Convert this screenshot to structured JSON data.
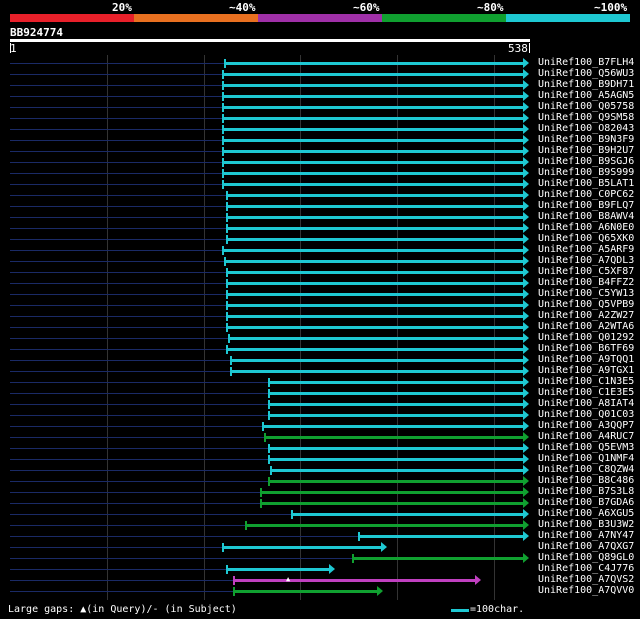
{
  "scale": {
    "labels": [
      "20%",
      "~40%",
      "~60%",
      "~80%",
      "~100%"
    ],
    "colors": [
      "#e8202a",
      "#e87020",
      "#a030a8",
      "#10a030",
      "#1ec8d2"
    ]
  },
  "query": {
    "id": "BB924774",
    "start": "1",
    "end": "538"
  },
  "colors": {
    "cyan": "#1ec8d2",
    "green": "#10a030",
    "magenta": "#c040c0"
  },
  "hits": [
    {
      "label": "UniRef100_B7FLH4",
      "start": 224,
      "end": 528,
      "color": "cyan"
    },
    {
      "label": "UniRef100_Q56WU3",
      "start": 222,
      "end": 528,
      "color": "cyan"
    },
    {
      "label": "UniRef100_B9DH71",
      "start": 222,
      "end": 528,
      "color": "cyan"
    },
    {
      "label": "UniRef100_A5AGN5",
      "start": 222,
      "end": 528,
      "color": "cyan"
    },
    {
      "label": "UniRef100_Q05758",
      "start": 222,
      "end": 528,
      "color": "cyan"
    },
    {
      "label": "UniRef100_Q9SM58",
      "start": 222,
      "end": 528,
      "color": "cyan"
    },
    {
      "label": "UniRef100_O82043",
      "start": 222,
      "end": 528,
      "color": "cyan"
    },
    {
      "label": "UniRef100_B9N3F9",
      "start": 222,
      "end": 528,
      "color": "cyan"
    },
    {
      "label": "UniRef100_B9H2U7",
      "start": 222,
      "end": 528,
      "color": "cyan"
    },
    {
      "label": "UniRef100_B9SGJ6",
      "start": 222,
      "end": 528,
      "color": "cyan"
    },
    {
      "label": "UniRef100_B9S999",
      "start": 222,
      "end": 528,
      "color": "cyan"
    },
    {
      "label": "UniRef100_B5LAT1",
      "start": 222,
      "end": 528,
      "color": "cyan"
    },
    {
      "label": "UniRef100_C0PC62",
      "start": 226,
      "end": 528,
      "color": "cyan"
    },
    {
      "label": "UniRef100_B9FLQ7",
      "start": 226,
      "end": 528,
      "color": "cyan"
    },
    {
      "label": "UniRef100_B8AWV4",
      "start": 226,
      "end": 528,
      "color": "cyan"
    },
    {
      "label": "UniRef100_A6N0E0",
      "start": 226,
      "end": 528,
      "color": "cyan"
    },
    {
      "label": "UniRef100_Q65XK0",
      "start": 226,
      "end": 528,
      "color": "cyan"
    },
    {
      "label": "UniRef100_A5ARF9",
      "start": 222,
      "end": 528,
      "color": "cyan"
    },
    {
      "label": "UniRef100_A7QDL3",
      "start": 224,
      "end": 528,
      "color": "cyan"
    },
    {
      "label": "UniRef100_C5XF87",
      "start": 226,
      "end": 528,
      "color": "cyan"
    },
    {
      "label": "UniRef100_B4FFZ2",
      "start": 226,
      "end": 528,
      "color": "cyan"
    },
    {
      "label": "UniRef100_C5YW13",
      "start": 226,
      "end": 528,
      "color": "cyan"
    },
    {
      "label": "UniRef100_Q5VPB9",
      "start": 226,
      "end": 528,
      "color": "cyan"
    },
    {
      "label": "UniRef100_A2ZW27",
      "start": 226,
      "end": 528,
      "color": "cyan"
    },
    {
      "label": "UniRef100_A2WTA6",
      "start": 226,
      "end": 528,
      "color": "cyan"
    },
    {
      "label": "UniRef100_Q01292",
      "start": 228,
      "end": 528,
      "color": "cyan"
    },
    {
      "label": "UniRef100_B6TF69",
      "start": 226,
      "end": 528,
      "color": "cyan"
    },
    {
      "label": "UniRef100_A9TQQ1",
      "start": 230,
      "end": 528,
      "color": "cyan"
    },
    {
      "label": "UniRef100_A9TGX1",
      "start": 230,
      "end": 528,
      "color": "cyan"
    },
    {
      "label": "UniRef100_C1N3E5",
      "start": 268,
      "end": 528,
      "color": "cyan"
    },
    {
      "label": "UniRef100_C1E3E5",
      "start": 268,
      "end": 528,
      "color": "cyan"
    },
    {
      "label": "UniRef100_A8IAT4",
      "start": 268,
      "end": 528,
      "color": "cyan"
    },
    {
      "label": "UniRef100_Q01C03",
      "start": 268,
      "end": 528,
      "color": "cyan"
    },
    {
      "label": "UniRef100_A3QQP7",
      "start": 262,
      "end": 528,
      "color": "cyan"
    },
    {
      "label": "UniRef100_A4RUC7",
      "start": 264,
      "end": 528,
      "color": "green"
    },
    {
      "label": "UniRef100_Q5EVM3",
      "start": 268,
      "end": 528,
      "color": "cyan"
    },
    {
      "label": "UniRef100_Q1NMF4",
      "start": 268,
      "end": 528,
      "color": "cyan"
    },
    {
      "label": "UniRef100_C8QZW4",
      "start": 270,
      "end": 528,
      "color": "cyan"
    },
    {
      "label": "UniRef100_B8C486",
      "start": 268,
      "end": 528,
      "color": "green"
    },
    {
      "label": "UniRef100_B7S3L8",
      "start": 260,
      "end": 528,
      "color": "green"
    },
    {
      "label": "UniRef100_B7GDA6",
      "start": 260,
      "end": 528,
      "color": "green"
    },
    {
      "label": "UniRef100_A6XGU5",
      "start": 291,
      "end": 528,
      "color": "cyan"
    },
    {
      "label": "UniRef100_B3U3W2",
      "start": 245,
      "end": 528,
      "color": "green"
    },
    {
      "label": "UniRef100_A7NY47",
      "start": 358,
      "end": 528,
      "color": "cyan"
    },
    {
      "label": "UniRef100_A7QXG7",
      "start": 222,
      "end": 386,
      "color": "cyan"
    },
    {
      "label": "UniRef100_Q89GL0",
      "start": 352,
      "end": 528,
      "color": "green"
    },
    {
      "label": "UniRef100_C4J776",
      "start": 226,
      "end": 334,
      "color": "cyan"
    },
    {
      "label": "UniRef100_A7QVS2",
      "start": 233,
      "end": 480,
      "color": "magenta",
      "gap": 286
    },
    {
      "label": "UniRef100_A7QVV0",
      "start": 233,
      "end": 382,
      "color": "green"
    }
  ],
  "footer": {
    "text": "Large gaps: ▲(in Query)/- (in Subject)",
    "legend": "=100char."
  }
}
